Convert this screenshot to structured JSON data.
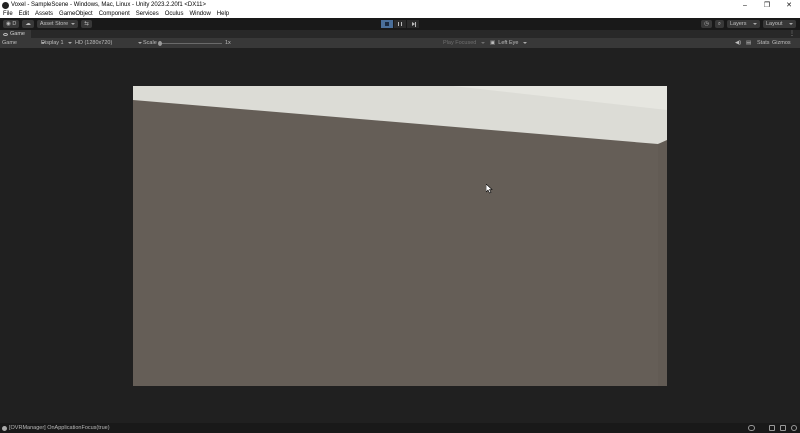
{
  "window": {
    "title": "Voxel - SampleScene - Windows, Mac, Linux - Unity 2023.2.20f1 <DX11>",
    "controls": [
      "–",
      "❐",
      "✕"
    ]
  },
  "menu": [
    "File",
    "Edit",
    "Assets",
    "GameObject",
    "Component",
    "Services",
    "Oculus",
    "Window",
    "Help"
  ],
  "toolbar": {
    "account_label": "D",
    "asset_store_label": "Asset Store",
    "layers_label": "Layers",
    "layout_label": "Layout",
    "play_state": "playing"
  },
  "tabs": [
    {
      "label": "Game",
      "icon": "game-eye-icon"
    }
  ],
  "gamebar": {
    "view_mode": "Game",
    "display": "Display 1",
    "resolution": "HD (1280x720)",
    "scale_label": "Scale",
    "scale_value": "1x",
    "play_focus": "Play Focused",
    "eye": "Left Eye",
    "stats_label": "Stats",
    "gizmos_label": "Gizmos"
  },
  "status": {
    "message": "[OVRManager] OnApplicationFocus(true)"
  },
  "colors": {
    "canvas_floor": "#655e57",
    "canvas_wall": "#dcdcd6",
    "editor_bg": "#202020",
    "play_active": "#4a6f9a"
  }
}
